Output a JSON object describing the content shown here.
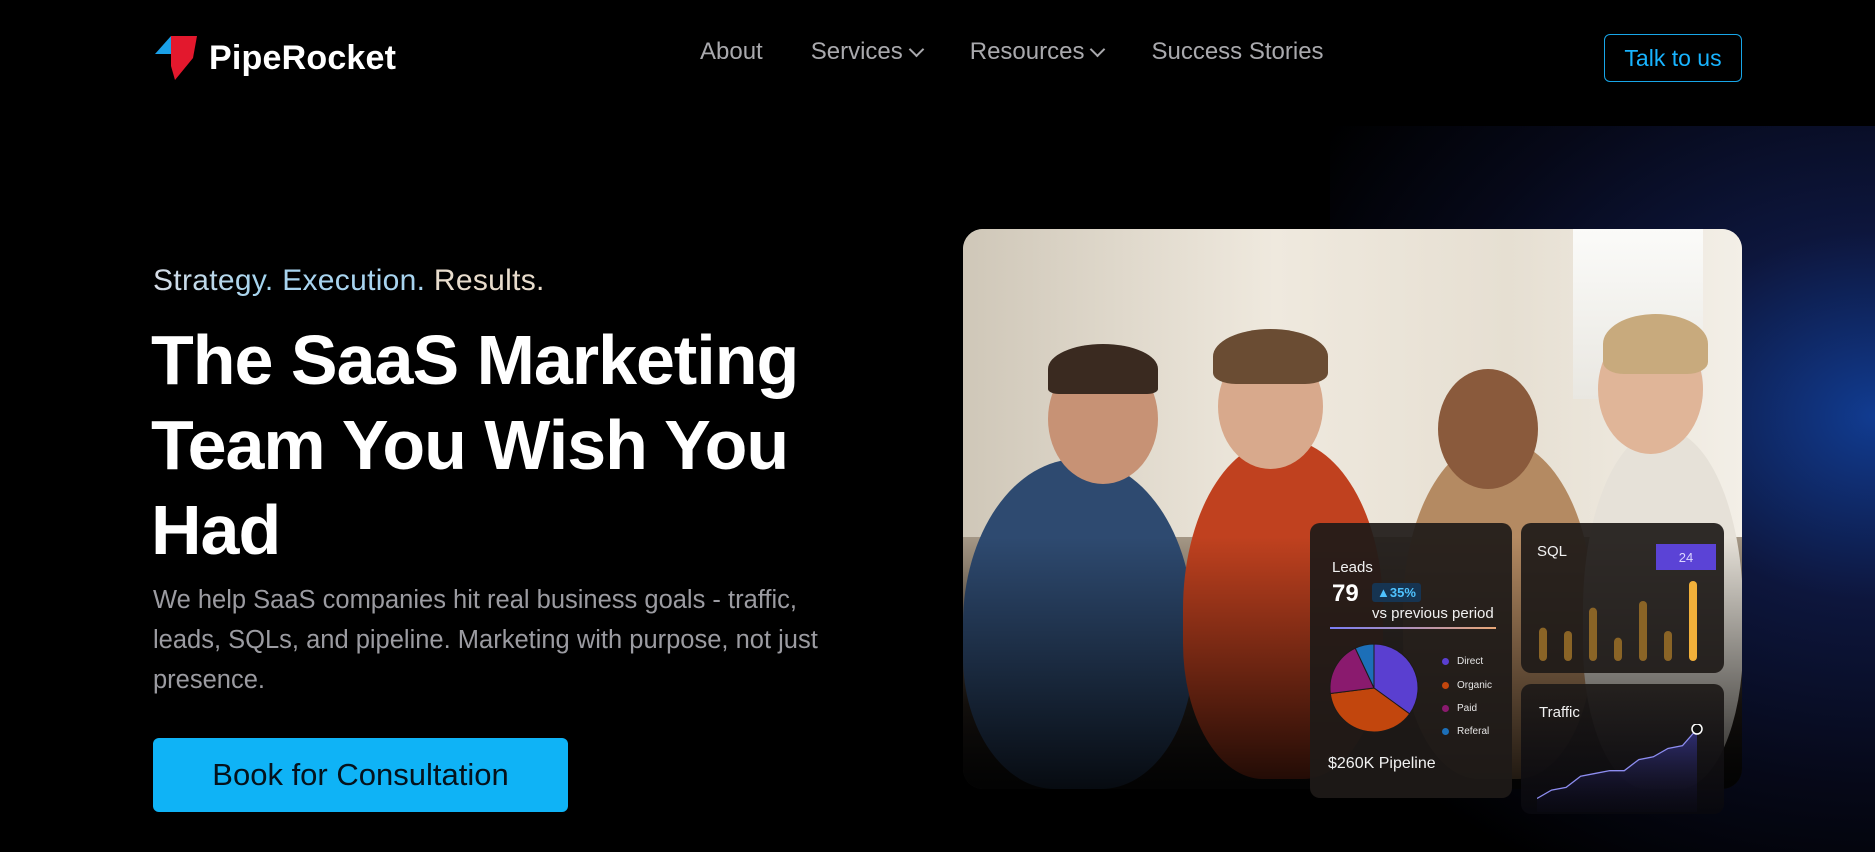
{
  "brand": {
    "name": "PipeRocket"
  },
  "nav": {
    "items": [
      {
        "label": "About",
        "has_dropdown": false
      },
      {
        "label": "Services",
        "has_dropdown": true
      },
      {
        "label": "Resources",
        "has_dropdown": true
      },
      {
        "label": "Success Stories",
        "has_dropdown": false
      }
    ],
    "cta_label": "Talk to us"
  },
  "hero": {
    "tagline": {
      "part1": "Strategy.",
      "part2": "Execution.",
      "part3": "Results."
    },
    "headline": "The SaaS Marketing Team You Wish You Had",
    "description": "We help SaaS companies hit real business goals - traffic, leads, SQLs, and pipeline. Marketing with purpose, not just presence.",
    "cta_label": "Book for Consultation"
  },
  "dashboard": {
    "leads": {
      "title": "Leads",
      "value": "79",
      "change": "35%",
      "comparison": "vs previous period",
      "legend": [
        "Direct",
        "Organic",
        "Paid",
        "Referal"
      ],
      "pipeline": "$260K Pipeline"
    },
    "sql": {
      "title": "SQL",
      "badge": "24"
    },
    "traffic": {
      "title": "Traffic"
    }
  },
  "colors": {
    "accent": "#0fb3f6",
    "background": "#000000",
    "logo_red": "#e3182d",
    "logo_blue": "#1aa0e8",
    "direct": "#5a3fd0",
    "organic": "#c2460d",
    "paid": "#8a1a6e",
    "referal": "#1c6fb8",
    "sql_bars": "#8a6426",
    "sql_highlight": "#f2b03a"
  },
  "chart_data": [
    {
      "type": "pie",
      "categories": [
        "Direct",
        "Organic",
        "Paid",
        "Referal"
      ],
      "values": [
        35,
        38,
        20,
        7
      ]
    },
    {
      "type": "bar",
      "title": "SQL",
      "values": [
        10,
        9,
        16,
        7,
        18,
        9,
        24
      ]
    },
    {
      "type": "area",
      "title": "Traffic",
      "values": [
        2,
        5,
        6,
        10,
        11,
        12,
        12,
        16,
        17,
        20,
        21,
        27
      ]
    }
  ]
}
